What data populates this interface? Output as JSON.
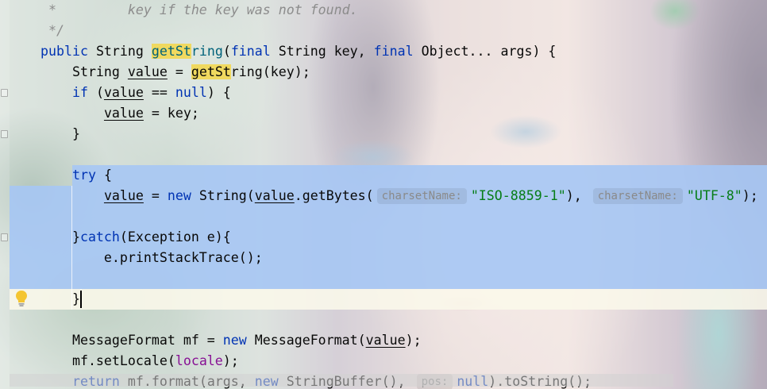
{
  "theme": {
    "plain": "#080808",
    "keyword": "#0033b3",
    "string": "#067d17",
    "comment": "#8c8c8c",
    "field": "#871094",
    "method_decl": "#00627a",
    "hint_text": "#8a8a8a",
    "search_match": "#f0d95f",
    "selection": "#a6c6f4",
    "caret_row": "#fbf8ea"
  },
  "icons": {
    "intention": "lightbulb-icon",
    "fold": "fold-icon"
  },
  "editor": {
    "lines": [
      {
        "tokens": [
          {
            "type": "comment",
            "text": " *         key if the key was not found."
          }
        ]
      },
      {
        "tokens": [
          {
            "type": "comment",
            "text": " */"
          }
        ]
      },
      {
        "tokens": [
          {
            "type": "keyword",
            "text": "public"
          },
          {
            "type": "plain",
            "text": " String "
          },
          {
            "type": "match-decl",
            "text": "getSt"
          },
          {
            "type": "method-decl",
            "text": "ring"
          },
          {
            "type": "plain",
            "text": "("
          },
          {
            "type": "keyword",
            "text": "final"
          },
          {
            "type": "plain",
            "text": " String key, "
          },
          {
            "type": "keyword",
            "text": "final"
          },
          {
            "type": "plain",
            "text": " Object... args) {"
          }
        ]
      },
      {
        "tokens": [
          {
            "type": "plain",
            "text": "    String "
          },
          {
            "type": "var",
            "text": "value"
          },
          {
            "type": "plain",
            "text": " = "
          },
          {
            "type": "match",
            "text": "getSt"
          },
          {
            "type": "plain",
            "text": "ring(key);"
          }
        ]
      },
      {
        "tokens": [
          {
            "type": "plain",
            "text": "    "
          },
          {
            "type": "keyword",
            "text": "if"
          },
          {
            "type": "plain",
            "text": " ("
          },
          {
            "type": "var",
            "text": "value"
          },
          {
            "type": "plain",
            "text": " == "
          },
          {
            "type": "keyword",
            "text": "null"
          },
          {
            "type": "plain",
            "text": ") {"
          }
        ]
      },
      {
        "tokens": [
          {
            "type": "plain",
            "text": "        "
          },
          {
            "type": "var",
            "text": "value"
          },
          {
            "type": "plain",
            "text": " = key;"
          }
        ]
      },
      {
        "tokens": [
          {
            "type": "plain",
            "text": "    }"
          }
        ]
      },
      {
        "tokens": []
      },
      {
        "tokens": [
          {
            "type": "plain",
            "text": "    "
          },
          {
            "type": "keyword",
            "text": "try"
          },
          {
            "type": "plain",
            "text": " {"
          }
        ]
      },
      {
        "tokens": [
          {
            "type": "plain",
            "text": "        "
          },
          {
            "type": "var",
            "text": "value"
          },
          {
            "type": "plain",
            "text": " = "
          },
          {
            "type": "keyword",
            "text": "new"
          },
          {
            "type": "plain",
            "text": " String("
          },
          {
            "type": "var",
            "text": "value"
          },
          {
            "type": "plain",
            "text": ".getBytes("
          },
          {
            "type": "hint",
            "text": "charsetName:"
          },
          {
            "type": "string",
            "text": "\"ISO-8859-1\""
          },
          {
            "type": "plain",
            "text": "), "
          },
          {
            "type": "hint",
            "text": "charsetName:"
          },
          {
            "type": "string",
            "text": "\"UTF-8\""
          },
          {
            "type": "plain",
            "text": ");"
          }
        ]
      },
      {
        "tokens": []
      },
      {
        "tokens": [
          {
            "type": "plain",
            "text": "    }"
          },
          {
            "type": "keyword",
            "text": "catch"
          },
          {
            "type": "plain",
            "text": "(Exception e){"
          }
        ]
      },
      {
        "tokens": [
          {
            "type": "plain",
            "text": "        e.printStackTrace();"
          }
        ]
      },
      {
        "tokens": []
      },
      {
        "tokens": [
          {
            "type": "plain",
            "text": "    }"
          }
        ]
      },
      {
        "tokens": []
      },
      {
        "tokens": [
          {
            "type": "plain",
            "text": "    MessageFormat mf = "
          },
          {
            "type": "keyword",
            "text": "new"
          },
          {
            "type": "plain",
            "text": " MessageFormat("
          },
          {
            "type": "var",
            "text": "value"
          },
          {
            "type": "plain",
            "text": ");"
          }
        ]
      },
      {
        "tokens": [
          {
            "type": "plain",
            "text": "    mf.setLocale("
          },
          {
            "type": "field",
            "text": "locale"
          },
          {
            "type": "plain",
            "text": ");"
          }
        ]
      },
      {
        "tokens": [
          {
            "type": "plain",
            "text": "    "
          },
          {
            "type": "keyword",
            "text": "return"
          },
          {
            "type": "plain",
            "text": " mf.format(args, "
          },
          {
            "type": "keyword",
            "text": "new"
          },
          {
            "type": "plain",
            "text": " StringBuffer(), "
          },
          {
            "type": "hint",
            "text": "pos:"
          },
          {
            "type": "keyword",
            "text": "null"
          },
          {
            "type": "plain",
            "text": ").toString();"
          }
        ]
      }
    ]
  }
}
